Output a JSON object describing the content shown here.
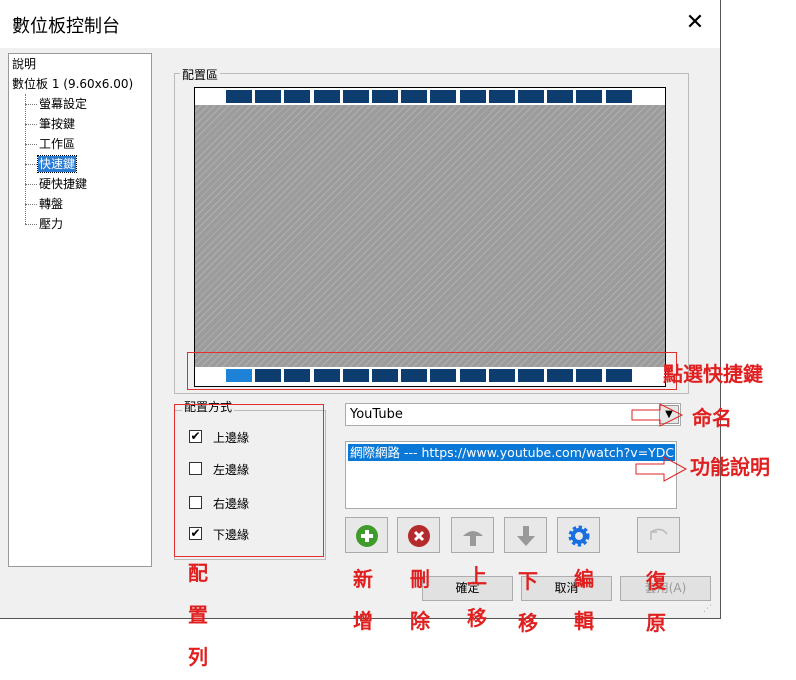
{
  "window": {
    "title": "數位板控制台",
    "close_icon": "close-icon"
  },
  "tree": {
    "items": [
      {
        "label": "說明"
      },
      {
        "label": "數位板  1 (9.60x6.00)"
      },
      {
        "label": "螢幕設定"
      },
      {
        "label": "筆按鍵"
      },
      {
        "label": "工作區"
      },
      {
        "label": "快速鍵",
        "selected": true
      },
      {
        "label": "硬快捷鍵"
      },
      {
        "label": "轉盤"
      },
      {
        "label": "壓力"
      }
    ]
  },
  "layout_area": {
    "label": "配置區",
    "top_slots": 14,
    "bottom_slots": 14,
    "selected_bottom_slot": 1,
    "slot_color": "#0c3d6e",
    "selected_slot_color": "#1e82d6"
  },
  "layout_mode": {
    "label": "配置方式",
    "options": [
      {
        "label": "上邊緣",
        "checked": true
      },
      {
        "label": "左邊緣",
        "checked": false
      },
      {
        "label": "右邊緣",
        "checked": false
      },
      {
        "label": "下邊緣",
        "checked": true
      }
    ]
  },
  "shortcut": {
    "name_value": "YouTube",
    "function_item": "網際網路 --- https://www.youtube.com/watch?v=YDC"
  },
  "tool_buttons": [
    {
      "name": "add",
      "icon": "plus-circle-icon"
    },
    {
      "name": "delete",
      "icon": "x-circle-icon"
    },
    {
      "name": "move-up",
      "icon": "arrow-up-icon"
    },
    {
      "name": "move-down",
      "icon": "arrow-down-icon"
    },
    {
      "name": "edit",
      "icon": "gear-icon"
    },
    {
      "name": "restore",
      "icon": "undo-icon"
    }
  ],
  "footer": {
    "ok": "確定",
    "cancel": "取消",
    "apply": "套用(A)"
  },
  "annotations": {
    "select_shortcut": "點選快捷鍵",
    "naming": "命名",
    "function_desc": "功能說明",
    "layout_bar": "配置列",
    "add": "新增",
    "delete": "刪除",
    "move_up": "上移",
    "move_down": "下移",
    "edit": "編輯",
    "restore": "復原",
    "color": "#e02020"
  }
}
